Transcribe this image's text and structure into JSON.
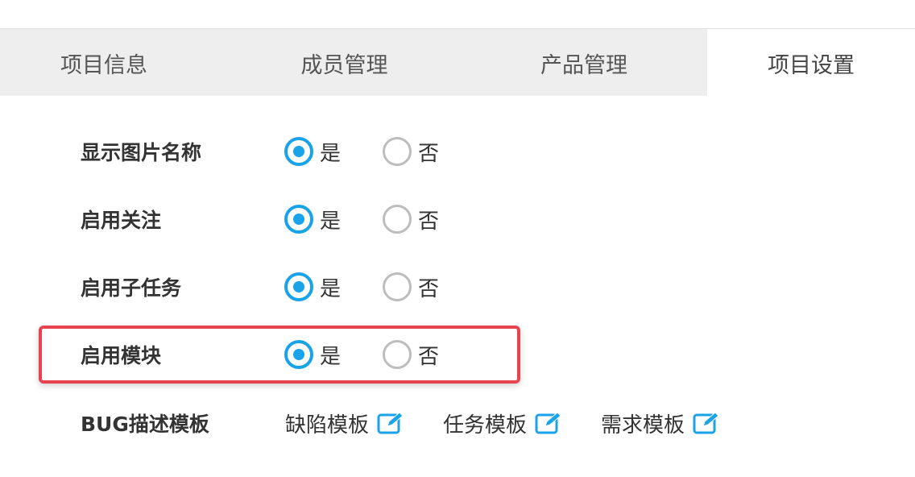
{
  "tabs": [
    {
      "label": "项目信息",
      "active": false
    },
    {
      "label": "成员管理",
      "active": false
    },
    {
      "label": "产品管理",
      "active": false
    },
    {
      "label": "项目设置",
      "active": true
    }
  ],
  "settings": [
    {
      "label": "显示图片名称",
      "yes": "是",
      "no": "否",
      "value": "yes"
    },
    {
      "label": "启用关注",
      "yes": "是",
      "no": "否",
      "value": "yes"
    },
    {
      "label": "启用子任务",
      "yes": "是",
      "no": "否",
      "value": "yes"
    },
    {
      "label": "启用模块",
      "yes": "是",
      "no": "否",
      "value": "yes",
      "highlighted": true
    }
  ],
  "bug_templates": {
    "label": "BUG描述模板",
    "items": [
      {
        "label": "缺陷模板",
        "icon": "edit-icon"
      },
      {
        "label": "任务模板",
        "icon": "edit-icon"
      },
      {
        "label": "需求模板",
        "icon": "edit-icon"
      }
    ]
  },
  "colors": {
    "accent": "#1aa3e8",
    "highlight_border": "#e8434f",
    "tab_bar_bg": "#eeeeee"
  }
}
